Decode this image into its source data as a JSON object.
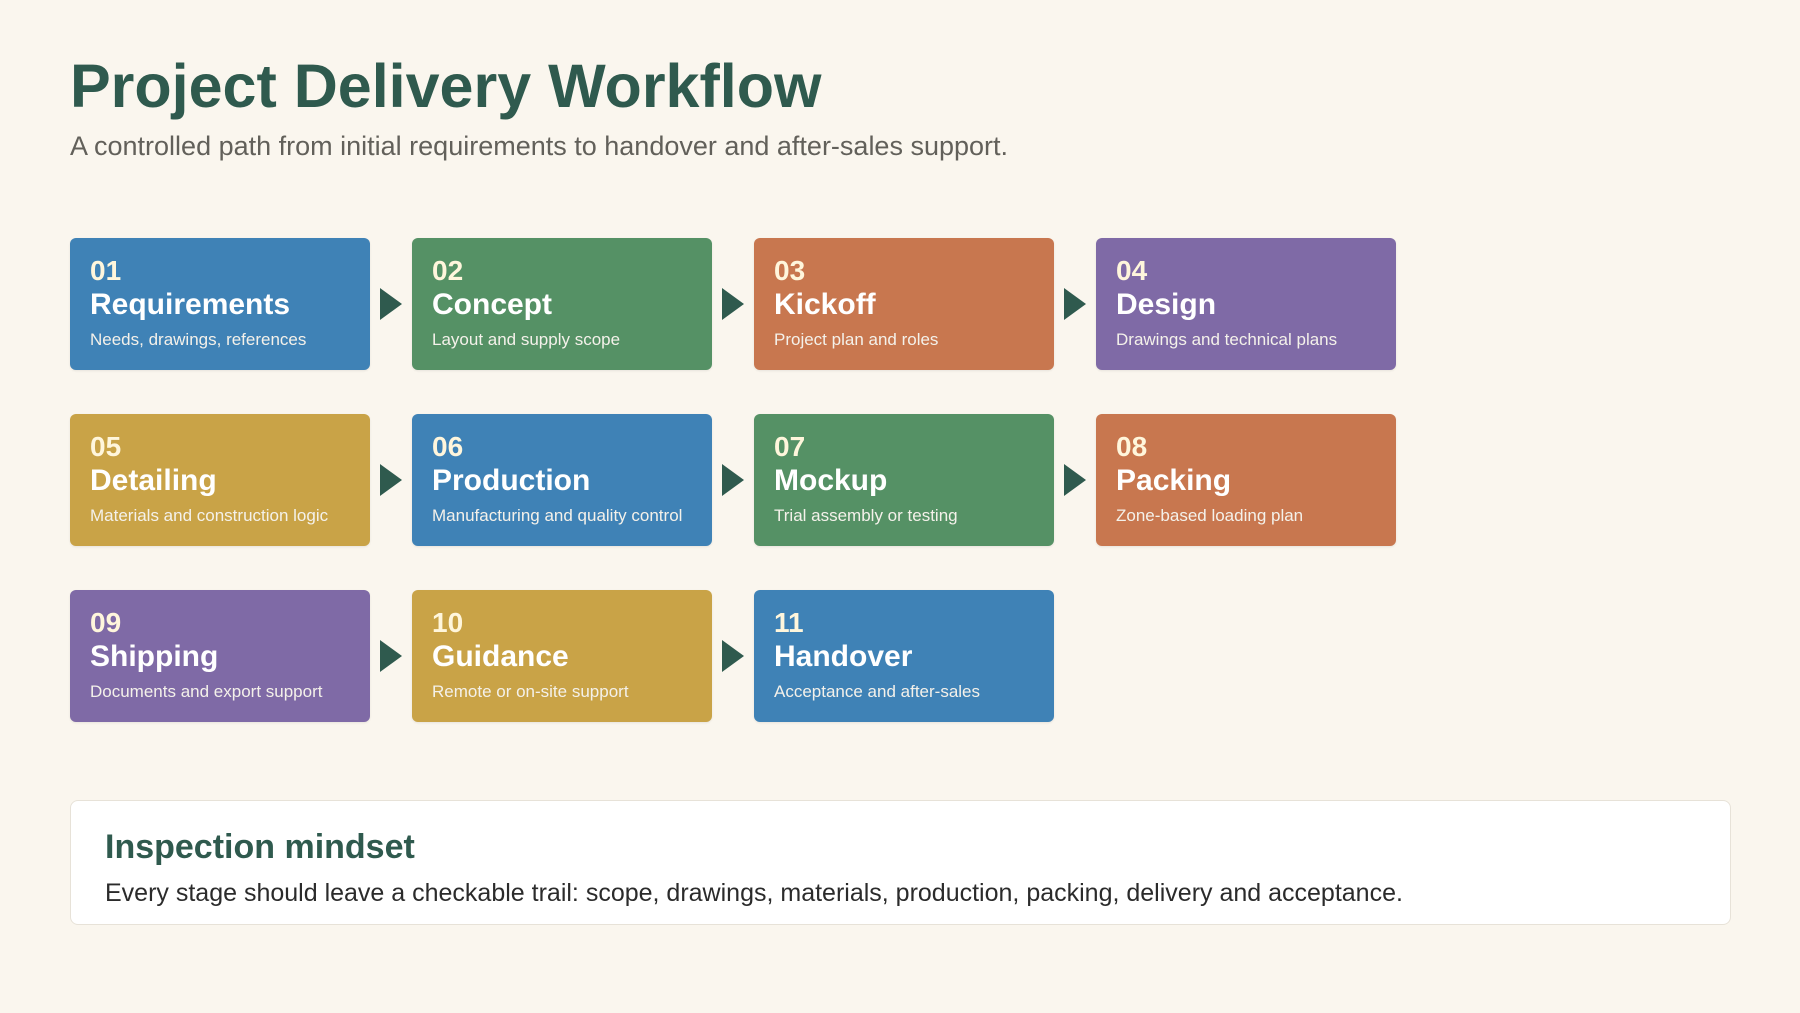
{
  "header": {
    "title": "Project Delivery Workflow",
    "subtitle": "A controlled path from initial requirements to handover and after-sales support."
  },
  "colors": {
    "blue": "#3f82b6",
    "green": "#559165",
    "orange": "#c8774f",
    "purple": "#7f6aa6",
    "gold": "#c9a347",
    "arrow": "#2f5a4e",
    "title": "#2f5a4e",
    "background": "#faf6ee"
  },
  "steps": [
    {
      "num": "01",
      "name": "Requirements",
      "desc": "Needs, drawings, references",
      "color": "#3f82b6"
    },
    {
      "num": "02",
      "name": "Concept",
      "desc": "Layout and supply scope",
      "color": "#559165"
    },
    {
      "num": "03",
      "name": "Kickoff",
      "desc": "Project plan and roles",
      "color": "#c8774f"
    },
    {
      "num": "04",
      "name": "Design",
      "desc": "Drawings and technical plans",
      "color": "#7f6aa6"
    },
    {
      "num": "05",
      "name": "Detailing",
      "desc": "Materials and construction logic",
      "color": "#c9a347"
    },
    {
      "num": "06",
      "name": "Production",
      "desc": "Manufacturing and quality control",
      "color": "#3f82b6"
    },
    {
      "num": "07",
      "name": "Mockup",
      "desc": "Trial assembly or testing",
      "color": "#559165"
    },
    {
      "num": "08",
      "name": "Packing",
      "desc": "Zone-based loading plan",
      "color": "#c8774f"
    },
    {
      "num": "09",
      "name": "Shipping",
      "desc": "Documents and export support",
      "color": "#7f6aa6"
    },
    {
      "num": "10",
      "name": "Guidance",
      "desc": "Remote or on-site support",
      "color": "#c9a347"
    },
    {
      "num": "11",
      "name": "Handover",
      "desc": "Acceptance and after-sales",
      "color": "#3f82b6"
    }
  ],
  "note": {
    "title": "Inspection mindset",
    "text": "Every stage should leave a checkable trail: scope, drawings, materials, production, packing, delivery and acceptance."
  }
}
